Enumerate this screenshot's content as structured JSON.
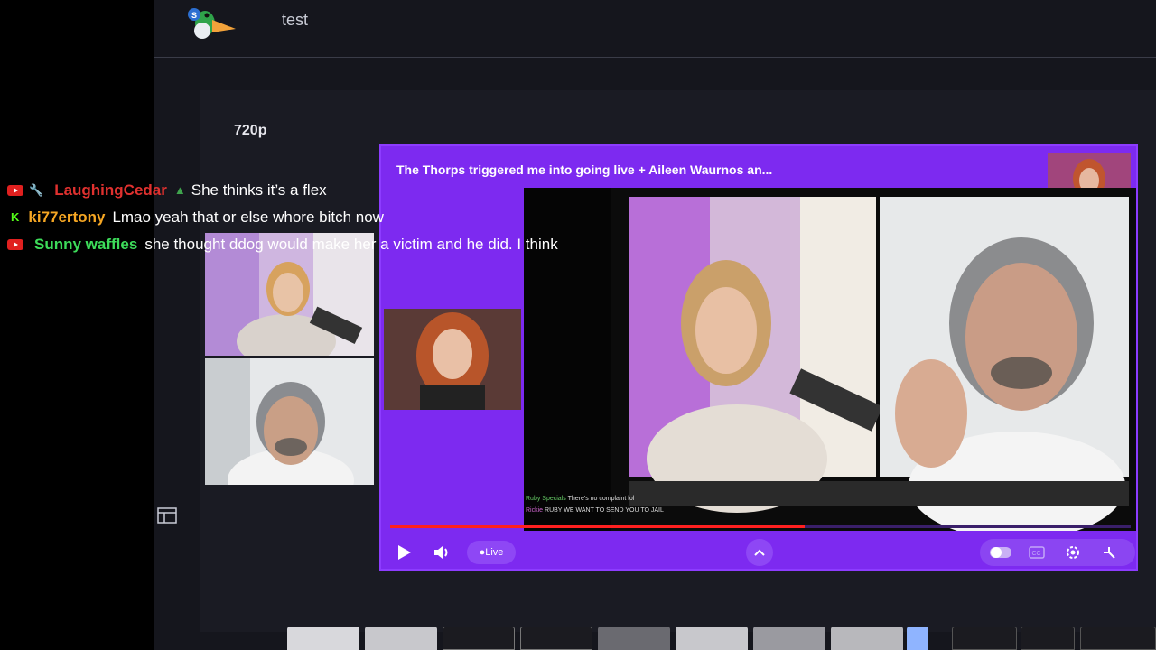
{
  "session": {
    "title": "test"
  },
  "view": {
    "resolution_label": "720p"
  },
  "chat": [
    {
      "platform_icon": "youtube-icon",
      "badge_icon": "wrench-icon",
      "name": "LaughingCedar",
      "name_color": "#e0312f",
      "suffix_icon": "tree-icon",
      "message": "She thinks it’s a flex"
    },
    {
      "platform_icon": "kick-icon",
      "badge_icon": "",
      "name": "ki77ertony",
      "name_color": "#f5a623",
      "suffix_icon": "",
      "message": "Lmao yeah that or else whore bitch now"
    },
    {
      "platform_icon": "youtube-icon",
      "badge_icon": "",
      "name": "Sunny waffles",
      "name_color": "#3ddc5a",
      "suffix_icon": "",
      "message": "she thought ddog would make her a victim and he did. I think"
    }
  ],
  "overlay": {
    "title": "The Thorps triggered me into going live + Aileen Waurnos an...",
    "resolution_label": "720p",
    "live_label": "Live",
    "progress": 0.56,
    "inner_chat": [
      {
        "name": "Ruby Specials",
        "text": "There's no complaint lol"
      },
      {
        "name": "Rickie",
        "text": "RUBY WE WANT TO SEND YOU TO JAIL"
      }
    ]
  },
  "colors": {
    "overlay_bg": "#7d2af0",
    "accent": "#8d3cff",
    "page_bg": "#15161d"
  }
}
